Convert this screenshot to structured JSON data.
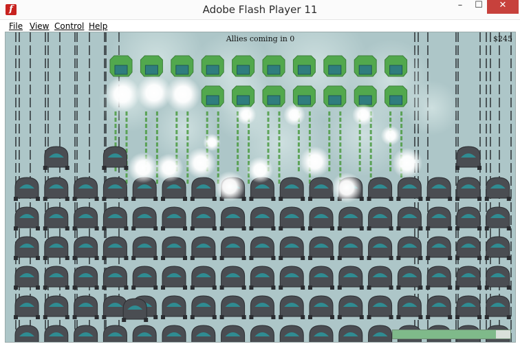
{
  "window": {
    "title": "Adobe Flash Player 11",
    "app_icon": "flash-icon",
    "minimize_glyph": "–",
    "maximize_glyph": "☐",
    "close_glyph": "✕"
  },
  "menu": {
    "items": [
      "File",
      "View",
      "Control",
      "Help"
    ]
  },
  "hud": {
    "allies_text": "Allies coming in 0",
    "money_text": "$245",
    "energy_level_fraction": 0.88
  },
  "colors": {
    "stage": "#adc6c8",
    "player_dark": "#4a4d52",
    "player_window": "#2f8c92",
    "enemy_green": "#52a84d",
    "enemy_window": "#2f7d7e",
    "track": "#2b3033",
    "laser": "#4d9c43"
  },
  "game": {
    "player_columns": 17,
    "player_rows": 6,
    "enemy_columns": 10,
    "enemy_rows": 2,
    "enemy_row2_first_column": 3,
    "extra_player_units_column": [
      1,
      3,
      15
    ],
    "dragged_unit_column": 4,
    "explosions": 16,
    "tracks": 22
  }
}
